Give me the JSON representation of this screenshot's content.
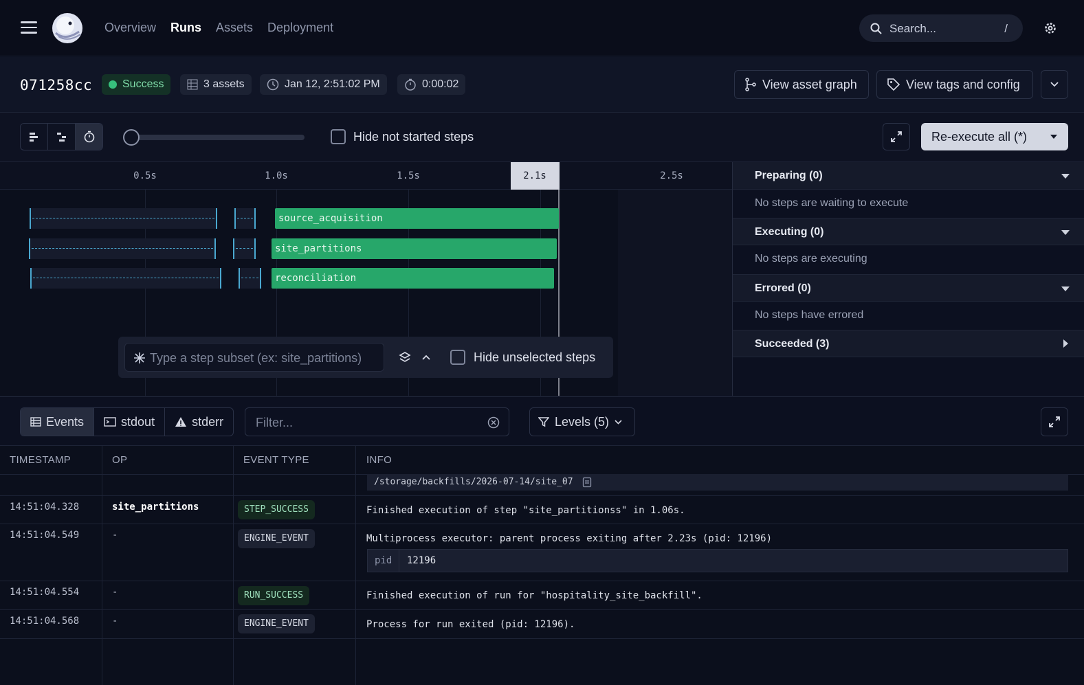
{
  "nav": {
    "links": [
      "Overview",
      "Runs",
      "Assets",
      "Deployment"
    ],
    "active": "Runs",
    "search_placeholder": "Search...",
    "search_shortcut": "/"
  },
  "run": {
    "id": "071258cc",
    "status": "Success",
    "assets": "3 assets",
    "started": "Jan 12, 2:51:02 PM",
    "duration": "0:00:02",
    "view_asset_graph": "View asset graph",
    "view_tags_config": "View tags and config"
  },
  "toolbar": {
    "hide_not_started": "Hide not started steps",
    "reexecute": "Re-execute all (*)"
  },
  "timeline": {
    "ticks": [
      "0.5s",
      "1.0s",
      "1.5s",
      "2.5s"
    ],
    "current": "2.1s",
    "steps": [
      "source_acquisition",
      "site_partitions",
      "reconciliation"
    ],
    "subset_placeholder": "Type a step subset (ex: site_partitions)",
    "hide_unselected": "Hide unselected steps"
  },
  "status_panel": [
    {
      "title": "Preparing (0)",
      "body": "No steps are waiting to execute"
    },
    {
      "title": "Executing (0)",
      "body": "No steps are executing"
    },
    {
      "title": "Errored (0)",
      "body": "No steps have errored"
    },
    {
      "title": "Succeeded (3)",
      "body": ""
    }
  ],
  "logs": {
    "tabs": [
      "Events",
      "stdout",
      "stderr"
    ],
    "filter_placeholder": "Filter...",
    "levels": "Levels (5)",
    "columns": [
      "TIMESTAMP",
      "OP",
      "EVENT TYPE",
      "INFO"
    ],
    "path": "/storage/backfills/2026-07-14/site_07",
    "rows": [
      {
        "ts": "14:51:04.328",
        "op": "site_partitions",
        "type": "STEP_SUCCESS",
        "info": "Finished execution of step \"site_partitionss\" in 1.06s."
      },
      {
        "ts": "14:51:04.549",
        "op": "-",
        "type": "ENGINE_EVENT",
        "info": "Multiprocess executor: parent process exiting after 2.23s (pid: 12196)"
      },
      {
        "ts": "14:51:04.554",
        "op": "-",
        "type": "RUN_SUCCESS",
        "info": "Finished execution of run for \"hospitality_site_backfill\"."
      },
      {
        "ts": "14:51:04.568",
        "op": "-",
        "type": "ENGINE_EVENT",
        "info": "Process for run exited (pid: 12196)."
      }
    ],
    "pid_key": "pid",
    "pid_value": "12196"
  },
  "colors": {
    "success": "#37c07c",
    "bar": "#27a76a",
    "dash": "#4aa8d0"
  }
}
